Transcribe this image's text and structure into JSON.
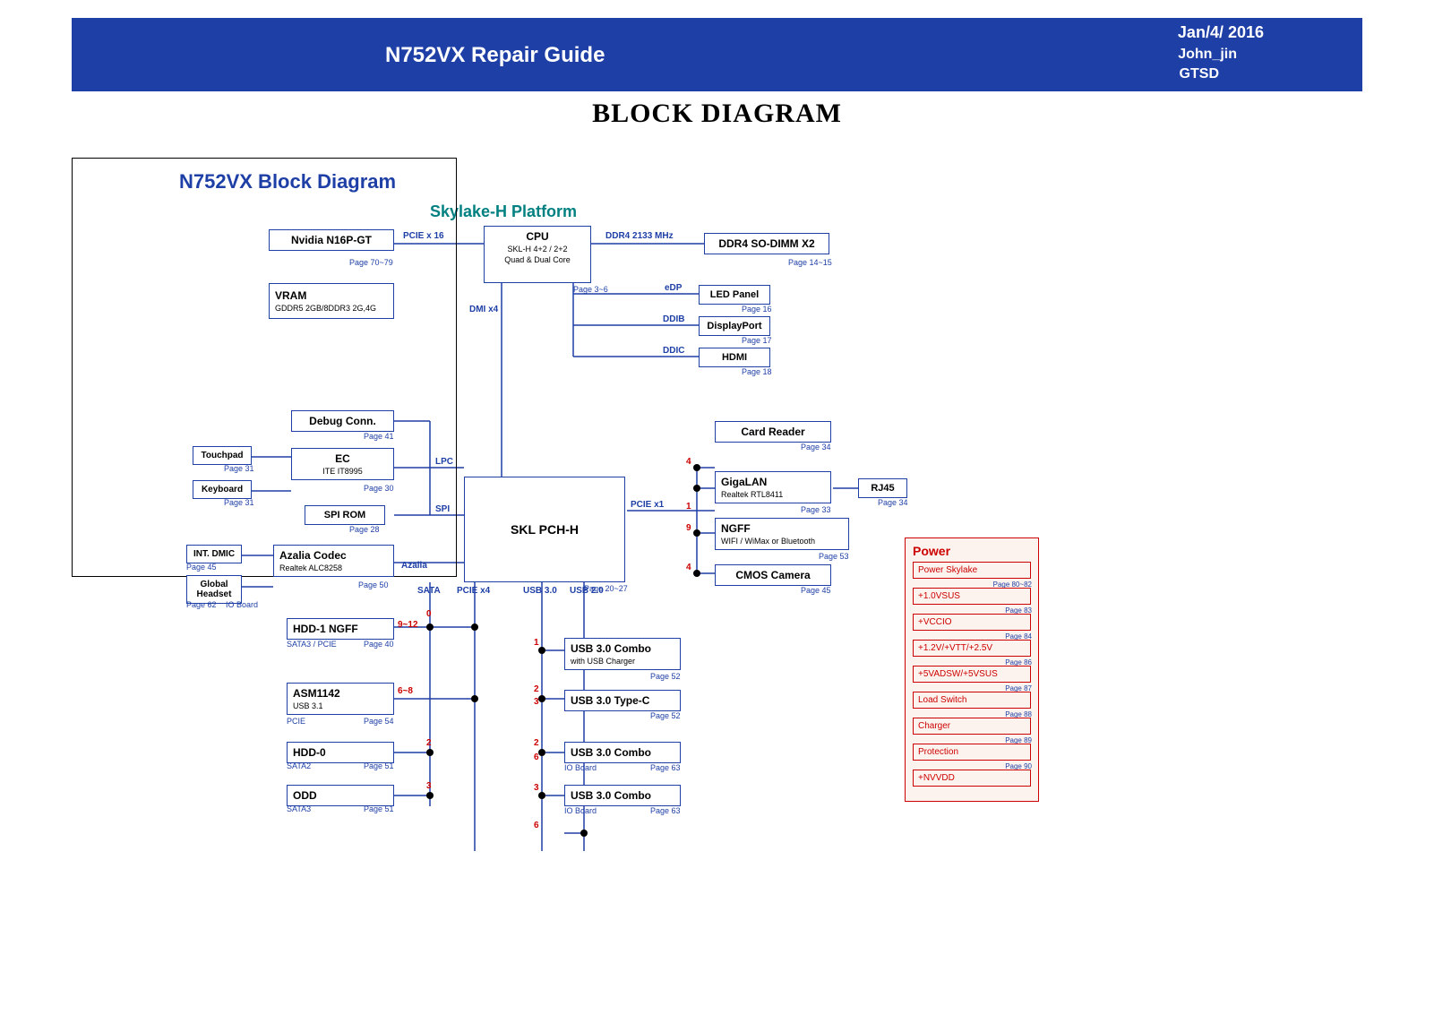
{
  "header": {
    "title": "N752VX Repair Guide",
    "date": "Jan/4/ 2016",
    "author": "John_jin",
    "dept": "GTSD"
  },
  "section_title": "BLOCK DIAGRAM",
  "diagram_title": "N752VX Block Diagram",
  "platform": "Skylake-H Platform",
  "blocks": {
    "gpu": {
      "label": "Nvidia N16P-GT",
      "page": "Page 70~79"
    },
    "vram": {
      "label": "VRAM",
      "sub": "GDDR5 2GB/8DDR3 2G,4G"
    },
    "cpu": {
      "label": "CPU",
      "sub1": "SKL-H 4+2 / 2+2",
      "sub2": "Quad & Dual Core",
      "page": "Page 3~6"
    },
    "ddr4": {
      "label": "DDR4 SO-DIMM X2",
      "page": "Page 14~15"
    },
    "led": {
      "label": "LED Panel",
      "page": "Page 16"
    },
    "dp": {
      "label": "DisplayPort",
      "page": "Page 17"
    },
    "hdmi": {
      "label": "HDMI",
      "page": "Page 18"
    },
    "debug": {
      "label": "Debug Conn.",
      "page": "Page 41"
    },
    "touchpad": {
      "label": "Touchpad",
      "page": "Page 31"
    },
    "keyboard": {
      "label": "Keyboard",
      "page": "Page 31"
    },
    "ec": {
      "label": "EC",
      "sub": "ITE IT8995",
      "page": "Page 30"
    },
    "spirom": {
      "label": "SPI ROM",
      "page": "Page 28"
    },
    "pch": {
      "label": "SKL PCH-H",
      "page": "Page 20~27"
    },
    "cardreader": {
      "label": "Card Reader",
      "page": "Page 34"
    },
    "gigalan": {
      "label": "GigaLAN",
      "sub": "Realtek RTL8411",
      "page": "Page 33"
    },
    "rj45": {
      "label": "RJ45",
      "page": "Page 34"
    },
    "ngff": {
      "label": "NGFF",
      "sub": "WIFI / WiMax or Bluetooth",
      "page": "Page 53"
    },
    "cmos": {
      "label": "CMOS Camera",
      "page": "Page 45"
    },
    "intdmic": {
      "label": "INT. DMIC",
      "page": "Page 45"
    },
    "azalia": {
      "label": "Azalia Codec",
      "sub": "Realtek ALC8258",
      "page": "Page 50"
    },
    "headset": {
      "label": "Global Headset",
      "page": "Page 62",
      "note": "IO Board"
    },
    "hdd1": {
      "label": "HDD-1 NGFF",
      "page": "Page 40",
      "note": "SATA3 / PCIE"
    },
    "asm": {
      "label": "ASM1142",
      "sub": "USB 3.1",
      "page": "Page 54",
      "note": "PCIE"
    },
    "hdd0": {
      "label": "HDD-0",
      "page": "Page 51",
      "note": "SATA2"
    },
    "odd": {
      "label": "ODD",
      "page": "Page 51",
      "note": "SATA3"
    },
    "usb30combo1": {
      "label": "USB 3.0 Combo",
      "sub": "with USB Charger",
      "page": "Page 52"
    },
    "usb30typec": {
      "label": "USB 3.0 Type-C",
      "page": "Page 52"
    },
    "usb30combo2": {
      "label": "USB 3.0 Combo",
      "page": "Page 63",
      "note": "IO Board"
    },
    "usb30combo3": {
      "label": "USB 3.0 Combo",
      "page": "Page 63",
      "note": "IO Board"
    }
  },
  "labels": {
    "pcie16": "PCIE x 16",
    "ddr4bus": "DDR4 2133 MHz",
    "dmi": "DMI x4",
    "edp": "eDP",
    "ddib": "DDIB",
    "ddic": "DDIC",
    "lpc": "LPC",
    "spi": "SPI",
    "azalia": "Azalia",
    "pcie1": "PCIE x1",
    "sata": "SATA",
    "pcie4": "PCIE x4",
    "usb30": "USB 3.0",
    "usb20": "USB 2.0",
    "r0": "0",
    "r912": "9~12",
    "r68": "6~8",
    "r1": "1",
    "r2": "2",
    "r3": "3",
    "r4": "4",
    "r6": "6",
    "r9": "9"
  },
  "power": {
    "title": "Power",
    "items": [
      {
        "label": "Power Skylake",
        "page": "Page 80~82"
      },
      {
        "label": "+1.0VSUS",
        "page": "Page 83"
      },
      {
        "label": "+VCCIO",
        "page": "Page 84"
      },
      {
        "label": "+1.2V/+VTT/+2.5V",
        "page": "Page 86"
      },
      {
        "label": "+5VADSW/+5VSUS",
        "page": "Page 87"
      },
      {
        "label": "Load Switch",
        "page": "Page 88"
      },
      {
        "label": "Charger",
        "page": "Page 89"
      },
      {
        "label": "Protection",
        "page": "Page 90"
      },
      {
        "label": "+NVVDD",
        "page": ""
      }
    ]
  }
}
